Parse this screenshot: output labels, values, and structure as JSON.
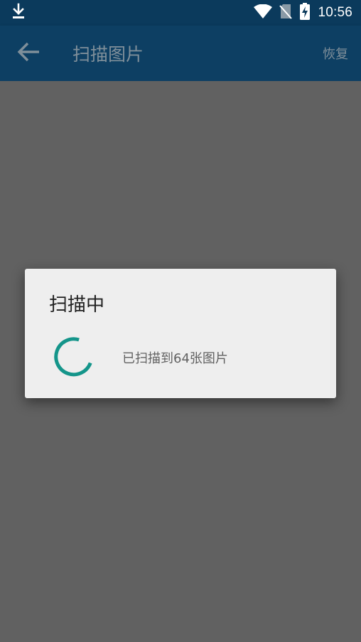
{
  "status_bar": {
    "time": "10:56",
    "icons": [
      "download-icon",
      "wifi-icon",
      "no-sim-icon",
      "battery-charging-icon"
    ]
  },
  "app_bar": {
    "back_icon": "arrow-back-icon",
    "title": "扫描图片",
    "action_label": "恢复"
  },
  "dialog": {
    "title": "扫描中",
    "message": "已扫描到64张图片",
    "spinner_icon": "progress-spinner-icon"
  },
  "colors": {
    "status_bar": "#0b3a5c",
    "app_bar": "#0d3f63",
    "scrim": "#616161",
    "dialog_bg": "#eeeeee",
    "spinner": "#14958a"
  }
}
